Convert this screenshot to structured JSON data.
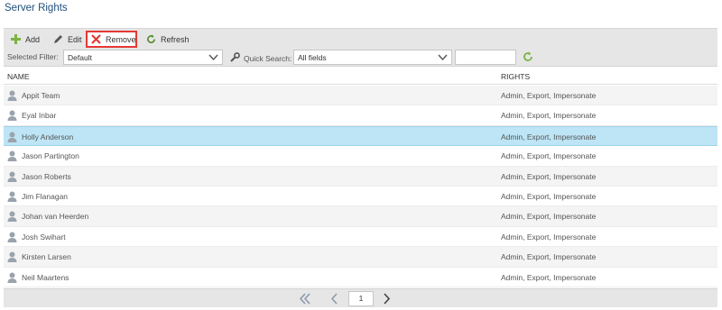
{
  "page": {
    "title": "Server Rights"
  },
  "toolbar": {
    "add_label": "Add",
    "edit_label": "Edit",
    "remove_label": "Remove",
    "refresh_label": "Refresh"
  },
  "filters": {
    "selected_filter_label": "Selected Filter:",
    "selected_filter_value": "Default",
    "quick_search_label": "Quick Search:",
    "quick_search_scope": "All fields",
    "search_value": ""
  },
  "grid": {
    "columns": {
      "name": "NAME",
      "rights": "RIGHTS"
    },
    "rows": [
      {
        "name": "Appit Team",
        "rights": "Admin, Export, Impersonate"
      },
      {
        "name": "Eyal Inbar",
        "rights": "Admin, Export, Impersonate"
      },
      {
        "name": "Holly Anderson",
        "rights": "Admin, Export, Impersonate",
        "selected": true
      },
      {
        "name": "Jason Partington",
        "rights": "Admin, Export, Impersonate"
      },
      {
        "name": "Jason Roberts",
        "rights": "Admin, Export, Impersonate"
      },
      {
        "name": "Jim Flanagan",
        "rights": "Admin, Export, Impersonate"
      },
      {
        "name": "Johan van Heerden",
        "rights": "Admin, Export, Impersonate"
      },
      {
        "name": "Josh Swihart",
        "rights": "Admin, Export, Impersonate"
      },
      {
        "name": "Kirsten Larsen",
        "rights": "Admin, Export, Impersonate"
      },
      {
        "name": "Neil Maartens",
        "rights": "Admin, Export, Impersonate"
      }
    ]
  },
  "pager": {
    "current_page": "1"
  },
  "icons": {
    "add": "plus-icon",
    "edit": "pencil-icon",
    "remove": "x-icon",
    "refresh": "refresh-icon",
    "quick_search": "wrench-icon",
    "user": "user-icon"
  },
  "colors": {
    "title": "#1f4f7c",
    "selected_row": "#bde5f5",
    "add_icon": "#7cb342",
    "remove_icon": "#e53935",
    "remove_highlight": "#e53935",
    "refresh_icon": "#558b2f",
    "search_refresh_icon": "#7cb342"
  }
}
